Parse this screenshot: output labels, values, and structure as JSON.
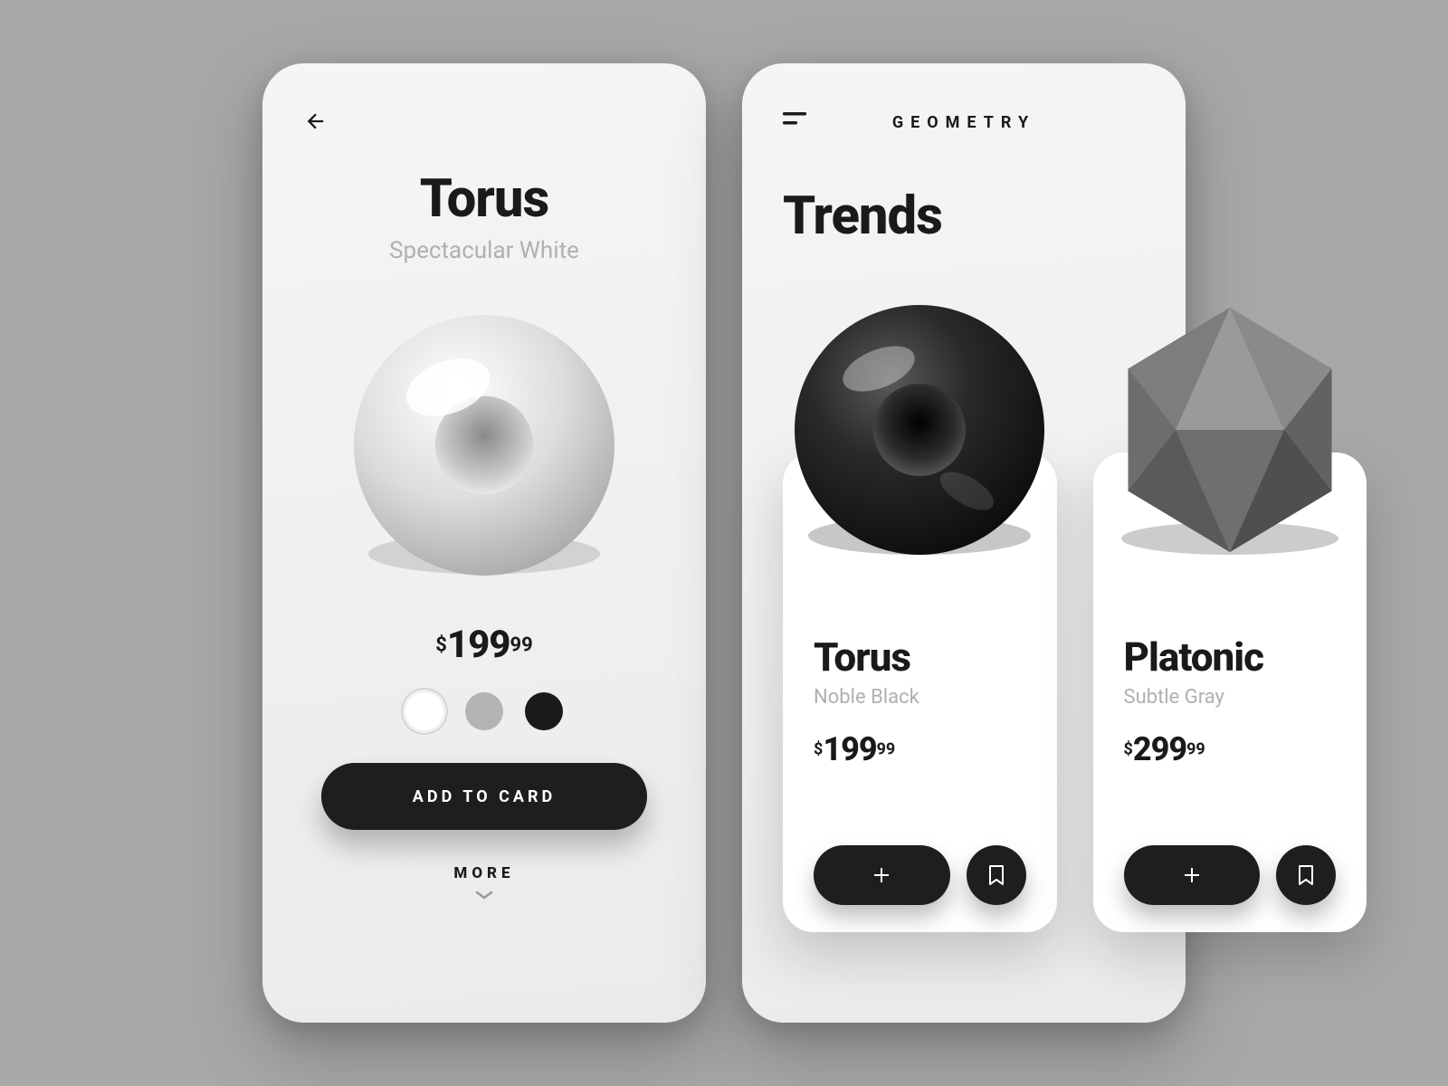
{
  "detail": {
    "title": "Torus",
    "subtitle": "Spectacular White",
    "price_currency": "$",
    "price_whole": "199",
    "price_cents": "99",
    "swatches": [
      {
        "color": "#ffffff",
        "selected": true
      },
      {
        "color": "#b3b3b3",
        "selected": false
      },
      {
        "color": "#1a1a1a",
        "selected": false
      }
    ],
    "cta_label": "ADD TO CARD",
    "more_label": "MORE"
  },
  "list": {
    "brand": "GEOMETRY",
    "section_title": "Trends",
    "products": [
      {
        "name": "Torus",
        "subtitle": "Noble Black",
        "price_currency": "$",
        "price_whole": "199",
        "price_cents": "99"
      },
      {
        "name": "Platonic",
        "subtitle": "Subtle Gray",
        "price_currency": "$",
        "price_whole": "299",
        "price_cents": "99"
      }
    ]
  }
}
